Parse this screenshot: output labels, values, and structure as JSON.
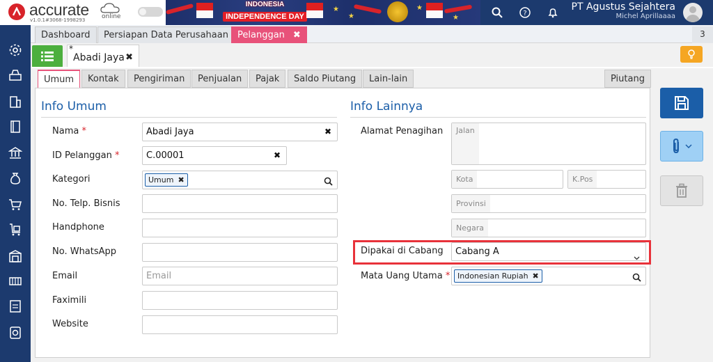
{
  "app": {
    "logo_text": "accurate",
    "logo_online": "online",
    "version": "v1.0.1#3068-1998293",
    "banner_line1": "INDONESIA",
    "banner_line2": "INDEPENDENCE DAY",
    "company_name": "PT Agustus Sejahtera",
    "user_name": "Michel Aprillaaaa"
  },
  "top_icons": [
    "search-icon",
    "help-icon",
    "bell-icon"
  ],
  "sidebar_icons": [
    "gear-icon",
    "cash-register-icon",
    "building-icon",
    "book-icon",
    "bank-icon",
    "money-bag-icon",
    "cart-icon",
    "shipping-cart-icon",
    "warehouse-icon",
    "production-icon",
    "tax-icon",
    "report-icon"
  ],
  "tabs": [
    {
      "label": "Dashboard",
      "active": false
    },
    {
      "label": "Persiapan Data Perusahaan",
      "active": false
    },
    {
      "label": "Pelanggan",
      "active": true,
      "close": "✖"
    }
  ],
  "tab_count": "3",
  "doc_tab": {
    "modified_mark": "*",
    "label": "Abadi Jaya",
    "close": "✖"
  },
  "inner_tabs": [
    "Umum",
    "Kontak",
    "Pengiriman",
    "Penjualan",
    "Pajak",
    "Saldo Piutang",
    "Lain-lain"
  ],
  "inner_tab_right": "Piutang",
  "info_umum": {
    "title": "Info Umum",
    "nama_label": "Nama",
    "nama_value": "Abadi Jaya",
    "id_label": "ID Pelanggan",
    "id_value": "C.00001",
    "kategori_label": "Kategori",
    "kategori_chip": "Umum",
    "telp_label": "No. Telp. Bisnis",
    "handphone_label": "Handphone",
    "whatsapp_label": "No. WhatsApp",
    "email_label": "Email",
    "email_placeholder": "Email",
    "faximili_label": "Faximili",
    "website_label": "Website",
    "required_mark": "*"
  },
  "info_lainnya": {
    "title": "Info Lainnya",
    "alamat_label": "Alamat Penagihan",
    "jalan_placeholder": "Jalan",
    "kota_placeholder": "Kota",
    "kpos_placeholder": "K.Pos",
    "provinsi_placeholder": "Provinsi",
    "negara_placeholder": "Negara",
    "cabang_label": "Dipakai di Cabang",
    "cabang_value": "Cabang A",
    "mata_uang_label": "Mata Uang Utama",
    "mata_uang_chip": "Indonesian Rupiah",
    "required_mark": "*"
  },
  "colors": {
    "navy": "#1c3a6e",
    "pink_tab": "#e8527a",
    "green": "#4caf3e",
    "blue": "#1b5ea8",
    "highlight": "#e8323a"
  }
}
